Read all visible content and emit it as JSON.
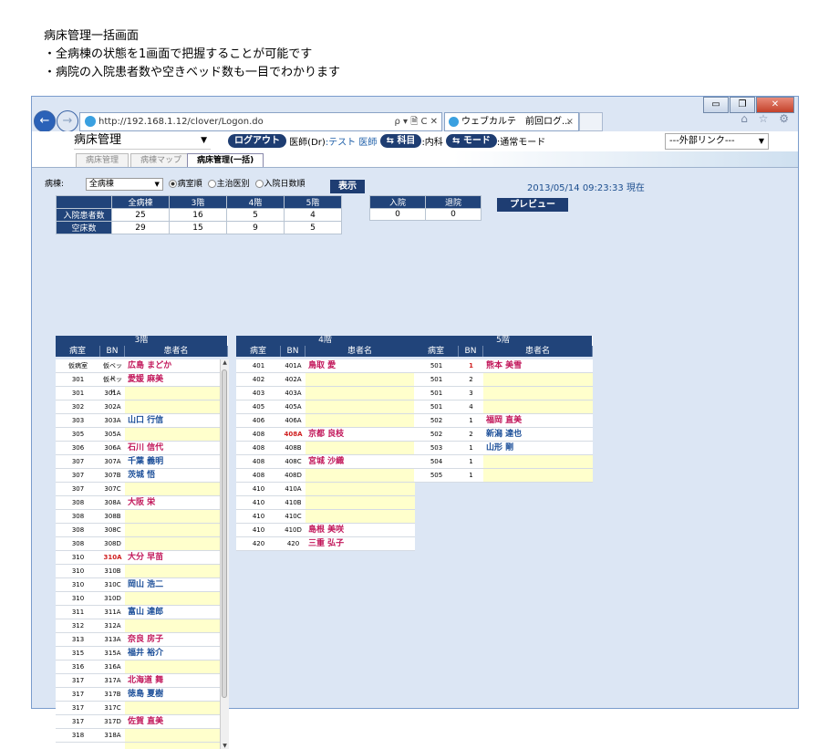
{
  "caption": {
    "title": "病床管理一括画面",
    "line1": "・全病棟の状態を1画面で把握することが可能です",
    "line2": "・病院の入院患者数や空きベッド数も一目でわかります"
  },
  "browser": {
    "url": "http://192.168.1.12/clover/Logon.do",
    "addr_tools": "ρ ▾ 🗎 C ✕",
    "tab_title": "ウェブカルテ　前回ログ...",
    "tab_close": "×",
    "right_icons": "⌂ ☆ ⚙",
    "win_min": "▭",
    "win_max": "❐",
    "win_close": "✕"
  },
  "appbar": {
    "module_select": "病床管理",
    "logout": "ログアウト",
    "doctor_label": "医師(Dr)",
    "user": ":テスト 医師",
    "dept_btn": "科目",
    "dept_val": ":内科",
    "mode_btn": "モード",
    "mode_val": ":通常モード",
    "ext_link": "---外部リンク---"
  },
  "tabs": [
    "病床管理",
    "病棟マップ",
    "病床管理(一括)"
  ],
  "controls": {
    "ward_label": "病棟:",
    "ward_value": "全病棟",
    "radio1": "病室順",
    "radio2": "主治医別",
    "radio3": "入院日数順",
    "display_btn": "表示",
    "datetime": "2013/05/14 09:23:33 現在",
    "preview_btn": "プレビュー"
  },
  "summary": {
    "headers": [
      "全病棟",
      "3階",
      "4階",
      "5階"
    ],
    "rows": [
      {
        "label": "入院患者数",
        "values": [
          "25",
          "16",
          "5",
          "4"
        ]
      },
      {
        "label": "空床数",
        "values": [
          "29",
          "15",
          "9",
          "5"
        ]
      }
    ],
    "adm_headers": [
      "入院",
      "退院"
    ],
    "adm_values": [
      "0",
      "0"
    ]
  },
  "wards": [
    {
      "title": "3階",
      "cols": [
        "病室",
        "BN",
        "患者名"
      ],
      "rows": [
        {
          "room": "仮病室",
          "bn": "仮ベッド",
          "name": "広島 まどか",
          "g": "f"
        },
        {
          "room": "301",
          "bn": "仮ベッド",
          "name": "愛媛 麻美",
          "g": "f"
        },
        {
          "room": "301",
          "bn": "301A",
          "name": "",
          "g": ""
        },
        {
          "room": "302",
          "bn": "302A",
          "name": "",
          "g": ""
        },
        {
          "room": "303",
          "bn": "303A",
          "name": "山口 行信",
          "g": "m"
        },
        {
          "room": "305",
          "bn": "305A",
          "name": "",
          "g": ""
        },
        {
          "room": "306",
          "bn": "306A",
          "name": "石川 信代",
          "g": "f"
        },
        {
          "room": "307",
          "bn": "307A",
          "name": "千葉 義明",
          "g": "m"
        },
        {
          "room": "307",
          "bn": "307B",
          "name": "茨城 悟",
          "g": "m"
        },
        {
          "room": "307",
          "bn": "307C",
          "name": "",
          "g": ""
        },
        {
          "room": "308",
          "bn": "308A",
          "name": "大阪 栄",
          "g": "f"
        },
        {
          "room": "308",
          "bn": "308B",
          "name": "",
          "g": ""
        },
        {
          "room": "308",
          "bn": "308C",
          "name": "",
          "g": ""
        },
        {
          "room": "308",
          "bn": "308D",
          "name": "",
          "g": ""
        },
        {
          "room": "310",
          "bn": "310A",
          "name": "大分 早苗",
          "g": "f",
          "red": true
        },
        {
          "room": "310",
          "bn": "310B",
          "name": "",
          "g": ""
        },
        {
          "room": "310",
          "bn": "310C",
          "name": "岡山 浩二",
          "g": "m"
        },
        {
          "room": "310",
          "bn": "310D",
          "name": "",
          "g": ""
        },
        {
          "room": "311",
          "bn": "311A",
          "name": "富山 達郎",
          "g": "m"
        },
        {
          "room": "312",
          "bn": "312A",
          "name": "",
          "g": ""
        },
        {
          "room": "313",
          "bn": "313A",
          "name": "奈良 房子",
          "g": "f"
        },
        {
          "room": "315",
          "bn": "315A",
          "name": "福井 裕介",
          "g": "m"
        },
        {
          "room": "316",
          "bn": "316A",
          "name": "",
          "g": ""
        },
        {
          "room": "317",
          "bn": "317A",
          "name": "北海道 舞",
          "g": "f"
        },
        {
          "room": "317",
          "bn": "317B",
          "name": "徳島 夏樹",
          "g": "m"
        },
        {
          "room": "317",
          "bn": "317C",
          "name": "",
          "g": ""
        },
        {
          "room": "317",
          "bn": "317D",
          "name": "佐賀 直美",
          "g": "f"
        },
        {
          "room": "318",
          "bn": "318A",
          "name": "",
          "g": ""
        },
        {
          "room": "",
          "bn": "",
          "name": "",
          "g": ""
        }
      ]
    },
    {
      "title": "4階",
      "cols": [
        "病室",
        "BN",
        "患者名"
      ],
      "rows": [
        {
          "room": "401",
          "bn": "401A",
          "name": "鳥取 愛",
          "g": "f"
        },
        {
          "room": "402",
          "bn": "402A",
          "name": "",
          "g": ""
        },
        {
          "room": "403",
          "bn": "403A",
          "name": "",
          "g": ""
        },
        {
          "room": "405",
          "bn": "405A",
          "name": "",
          "g": ""
        },
        {
          "room": "406",
          "bn": "406A",
          "name": "",
          "g": ""
        },
        {
          "room": "408",
          "bn": "408A",
          "name": "京都 良枝",
          "g": "f",
          "red": true
        },
        {
          "room": "408",
          "bn": "408B",
          "name": "",
          "g": ""
        },
        {
          "room": "408",
          "bn": "408C",
          "name": "宮城 沙織",
          "g": "f"
        },
        {
          "room": "408",
          "bn": "408D",
          "name": "",
          "g": ""
        },
        {
          "room": "410",
          "bn": "410A",
          "name": "",
          "g": ""
        },
        {
          "room": "410",
          "bn": "410B",
          "name": "",
          "g": ""
        },
        {
          "room": "410",
          "bn": "410C",
          "name": "",
          "g": ""
        },
        {
          "room": "410",
          "bn": "410D",
          "name": "島根 美咲",
          "g": "f"
        },
        {
          "room": "420",
          "bn": "420",
          "name": "三重 弘子",
          "g": "f"
        }
      ]
    },
    {
      "title": "5階",
      "cols": [
        "病室",
        "BN",
        "患者名"
      ],
      "rows": [
        {
          "room": "501",
          "bn": "1",
          "name": "熊本 美雪",
          "g": "f",
          "red": true
        },
        {
          "room": "501",
          "bn": "2",
          "name": "",
          "g": ""
        },
        {
          "room": "501",
          "bn": "3",
          "name": "",
          "g": ""
        },
        {
          "room": "501",
          "bn": "4",
          "name": "",
          "g": ""
        },
        {
          "room": "502",
          "bn": "1",
          "name": "福岡 直美",
          "g": "f"
        },
        {
          "room": "502",
          "bn": "2",
          "name": "新潟 達也",
          "g": "m"
        },
        {
          "room": "503",
          "bn": "1",
          "name": "山形 剛",
          "g": "m"
        },
        {
          "room": "504",
          "bn": "1",
          "name": "",
          "g": ""
        },
        {
          "room": "505",
          "bn": "1",
          "name": "",
          "g": ""
        }
      ]
    }
  ]
}
